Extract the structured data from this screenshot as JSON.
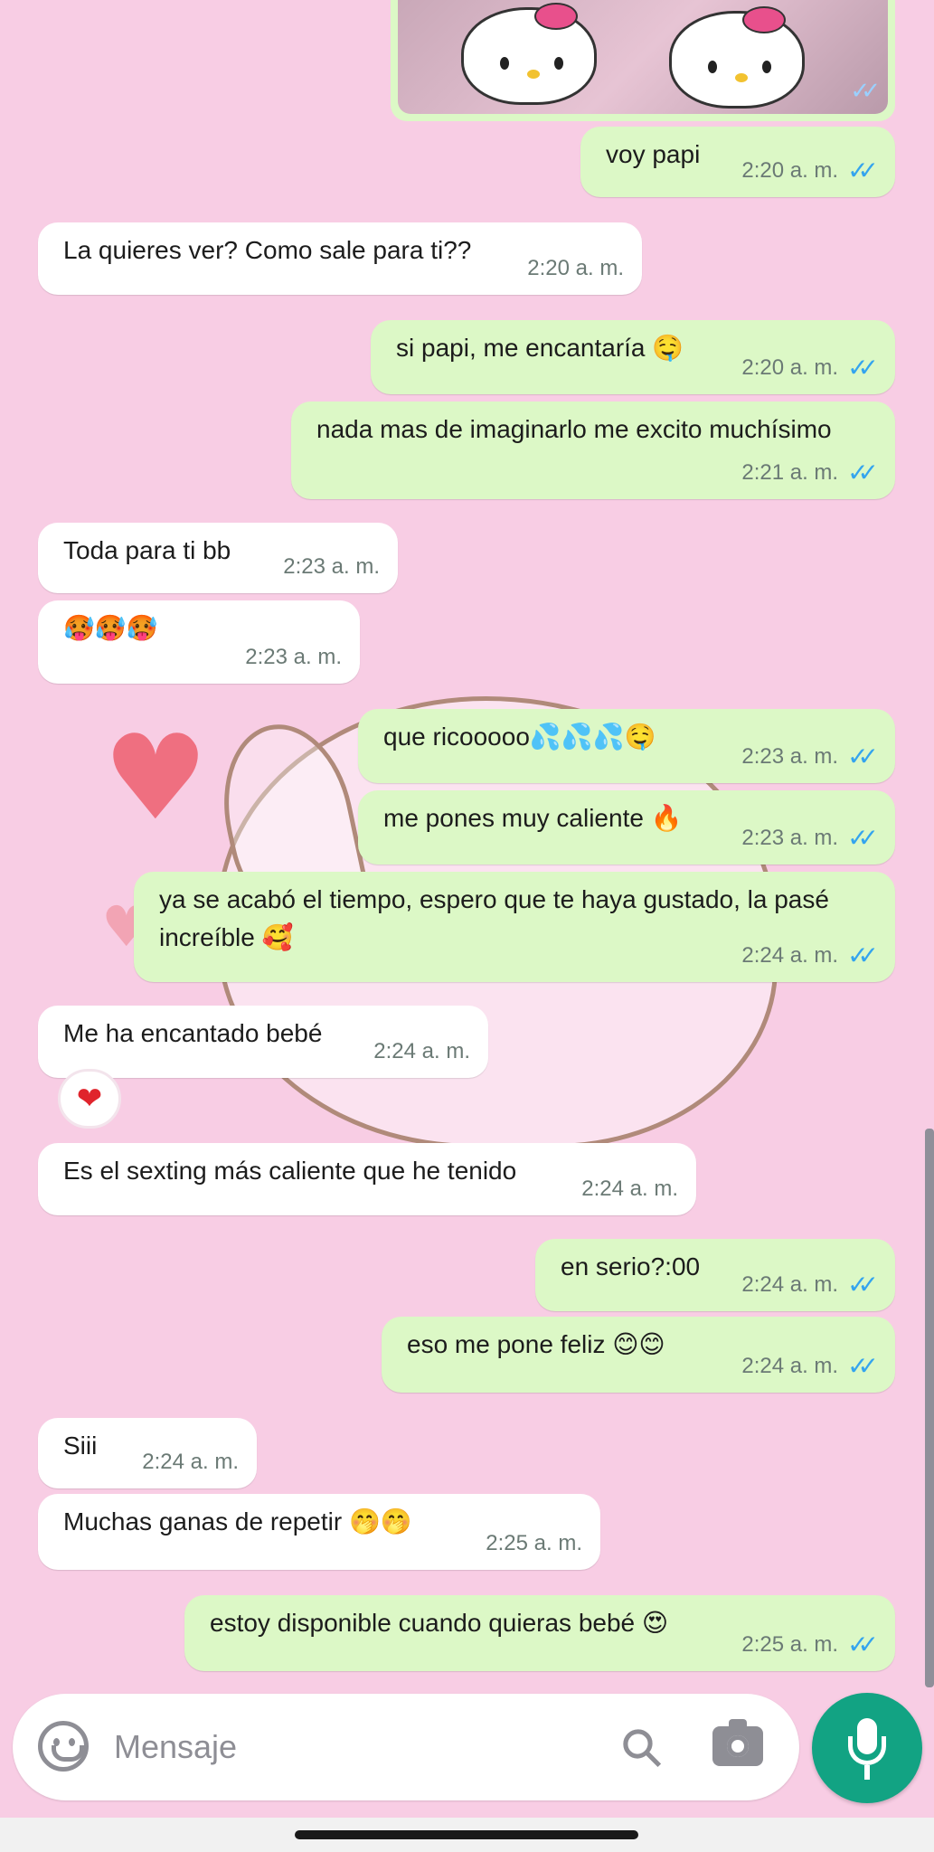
{
  "chat": {
    "messages": [
      {
        "dir": "out",
        "text": "voy papi",
        "time": "2:20 a. m.",
        "status": "read"
      },
      {
        "dir": "in",
        "text": "La quieres ver? Como sale para ti??",
        "time": "2:20 a. m."
      },
      {
        "dir": "out",
        "text": "si papi, me encantaría 🤤",
        "time": "2:20 a. m.",
        "status": "read"
      },
      {
        "dir": "out",
        "text": "nada mas de imaginarlo me excito muchísimo",
        "time": "2:21 a. m.",
        "status": "read"
      },
      {
        "dir": "in",
        "text": "Toda para ti bb",
        "time": "2:23 a. m."
      },
      {
        "dir": "in",
        "text": "🥵🥵🥵",
        "time": "2:23 a. m."
      },
      {
        "dir": "out",
        "text": "que ricooooo💦💦💦🤤",
        "time": "2:23 a. m.",
        "status": "read"
      },
      {
        "dir": "out",
        "text": "me pones muy caliente 🔥",
        "time": "2:23 a. m.",
        "status": "read"
      },
      {
        "dir": "out",
        "text_line1": "ya se acabó el tiempo, espero que te haya gustado, la pasé",
        "text_line2": "increíble 🥰",
        "time": "2:24 a. m.",
        "status": "read"
      },
      {
        "dir": "in",
        "text": "Me ha encantado bebé",
        "time": "2:24 a. m.",
        "reaction": "❤"
      },
      {
        "dir": "in",
        "text": "Es el sexting más caliente que he tenido",
        "time": "2:24 a. m."
      },
      {
        "dir": "out",
        "text": "en serio?:00",
        "time": "2:24 a. m.",
        "status": "read"
      },
      {
        "dir": "out",
        "text": "eso me pone feliz 😊😊",
        "time": "2:24 a. m.",
        "status": "read"
      },
      {
        "dir": "in",
        "text": "Siii",
        "time": "2:24 a. m."
      },
      {
        "dir": "in",
        "text": "Muchas ganas de repetir 🤭🤭",
        "time": "2:25 a. m."
      },
      {
        "dir": "out",
        "text": "estoy disponible cuando quieras bebé 😍",
        "time": "2:25 a. m.",
        "status": "read"
      }
    ],
    "read_ticks": "✓✓",
    "colors": {
      "background": "#f8cde4",
      "incoming_bubble": "#ffffff",
      "outgoing_bubble": "#dcf8c6",
      "read_ticks": "#34a4ee",
      "mic_button": "#12a383"
    }
  },
  "composer": {
    "placeholder": "Mensaje",
    "icons": [
      "emoji-icon",
      "attach-icon",
      "camera-icon",
      "mic-icon"
    ]
  }
}
